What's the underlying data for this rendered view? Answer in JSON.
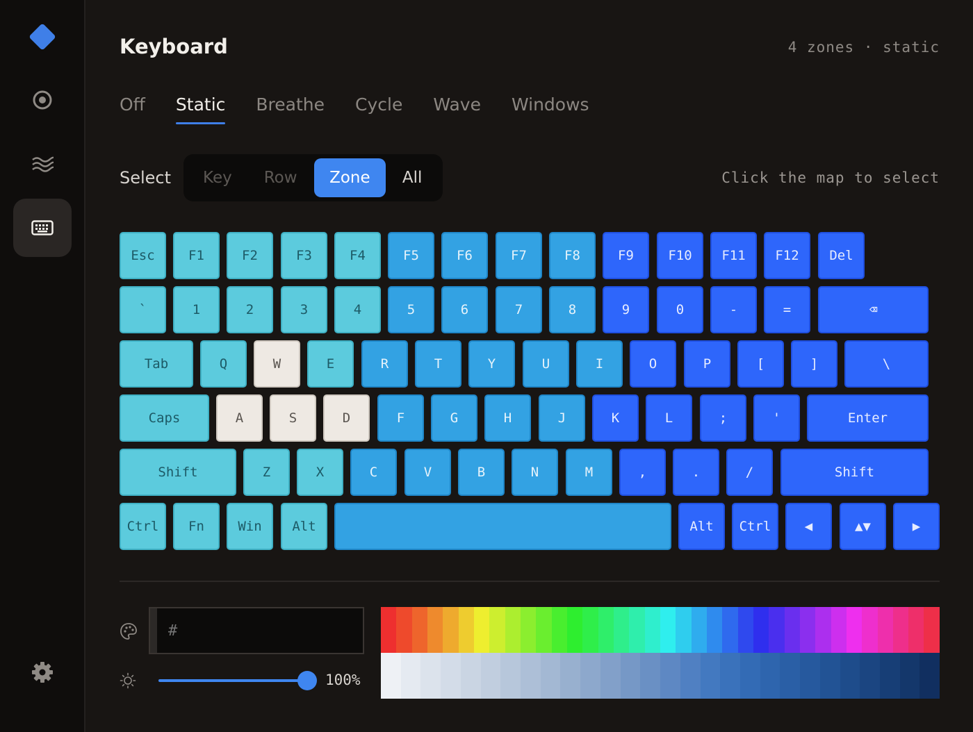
{
  "sidebar": {
    "items": [
      {
        "name": "logo",
        "icon": "diamond-logo-icon"
      },
      {
        "name": "target",
        "icon": "target-icon"
      },
      {
        "name": "wave",
        "icon": "wave-icon"
      },
      {
        "name": "keyboard",
        "icon": "keyboard-icon",
        "active": true
      },
      {
        "name": "settings",
        "icon": "gear-icon"
      }
    ]
  },
  "header": {
    "title": "Keyboard",
    "meta": "4 zones · static"
  },
  "tabs": [
    "Off",
    "Static",
    "Breathe",
    "Cycle",
    "Wave",
    "Windows"
  ],
  "active_tab": "Static",
  "select": {
    "label": "Select",
    "options": [
      "Key",
      "Row",
      "Zone",
      "All"
    ],
    "active": "Zone",
    "hint": "Click the map to select"
  },
  "keyboard": {
    "zone_colors": {
      "teal": "#5ccbdd",
      "mid": "#33a2e3",
      "blue": "#2e66fb",
      "selected": "#eee9e3"
    },
    "rows": [
      [
        "Esc",
        "F1",
        "F2",
        "F3",
        "F4",
        "F5",
        "F6",
        "F7",
        "F8",
        "F9",
        "F10",
        "F11",
        "F12",
        "Del"
      ],
      [
        "`",
        "1",
        "2",
        "3",
        "4",
        "5",
        "6",
        "7",
        "8",
        "9",
        "0",
        "-",
        "=",
        "⌫"
      ],
      [
        "Tab",
        "Q",
        "W",
        "E",
        "R",
        "T",
        "Y",
        "U",
        "I",
        "O",
        "P",
        "[",
        "]",
        "\\"
      ],
      [
        "Caps",
        "A",
        "S",
        "D",
        "F",
        "G",
        "H",
        "J",
        "K",
        "L",
        ";",
        "'",
        "Enter"
      ],
      [
        "Shift",
        "Z",
        "X",
        "C",
        "V",
        "B",
        "N",
        "M",
        ",",
        ".",
        "/",
        "Shift"
      ],
      [
        "Ctrl",
        "Fn",
        "Win",
        "Alt",
        "",
        "Alt",
        "Ctrl",
        "◀",
        "▲▼",
        "▶"
      ]
    ]
  },
  "color": {
    "hex_placeholder": "#",
    "hex_value": "",
    "current_swatch": "#2c2927",
    "brightness": "100%"
  }
}
